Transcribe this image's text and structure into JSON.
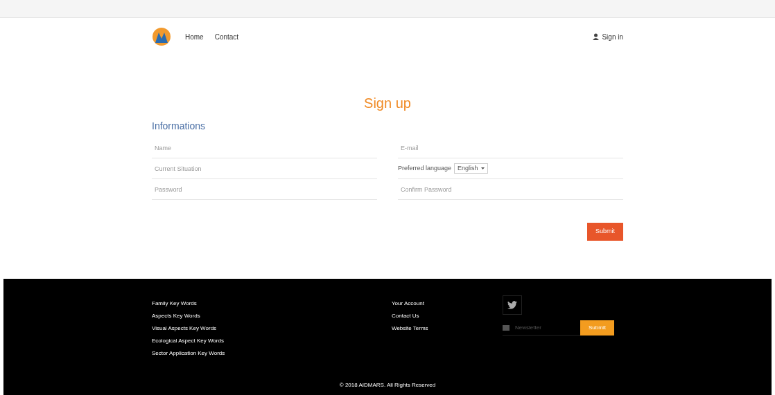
{
  "header": {
    "nav": [
      {
        "label": "Home"
      },
      {
        "label": "Contact"
      }
    ],
    "sign_in": "Sign in"
  },
  "form": {
    "title": "Sign up",
    "section": "Informations",
    "fields": [
      {
        "kind": "input",
        "placeholder": "Name"
      },
      {
        "kind": "input",
        "placeholder": "E-mail"
      },
      {
        "kind": "input",
        "placeholder": "Current Situation"
      },
      {
        "kind": "select",
        "label": "Preferred language",
        "value": "English"
      },
      {
        "kind": "input",
        "placeholder": "Password"
      },
      {
        "kind": "input",
        "placeholder": "Confirm Password"
      }
    ],
    "submit": "Submit"
  },
  "footer": {
    "links_1": [
      "Family Key Words",
      "Aspects Key Words",
      "Visual Aspects Key Words",
      "Ecological Aspect Key Words",
      "Sector Application Key Words"
    ],
    "links_2": [
      "Your Account",
      "Contact Us",
      "Website Terms"
    ],
    "newsletter": {
      "placeholder": "Newsletter",
      "button": "Submit"
    },
    "copyright": "© 2018 AIDMARS. All Rights Reserved"
  }
}
